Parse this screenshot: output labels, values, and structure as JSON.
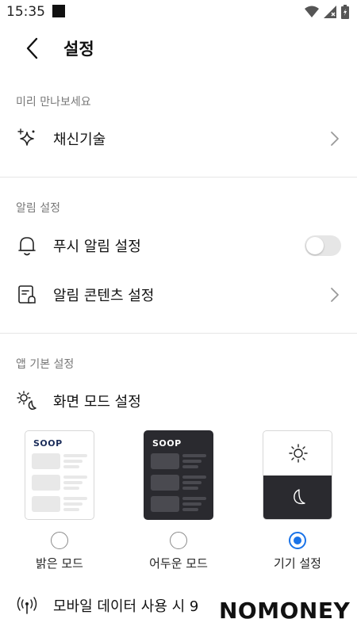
{
  "status_bar": {
    "time": "15:35"
  },
  "header": {
    "title": "설정"
  },
  "sections": {
    "preview": {
      "label": "미리 만나보세요",
      "item_label": "채신기술"
    },
    "notifications": {
      "label": "알림 설정",
      "push_label": "푸시 알림 설정",
      "push_enabled": false,
      "content_label": "알림 콘텐츠 설정"
    },
    "app_basic": {
      "label": "앱 기본 설정",
      "screen_mode_label": "화면 모드 설정",
      "modes": [
        {
          "label": "밝은 모드",
          "selected": false
        },
        {
          "label": "어두운 모드",
          "selected": false
        },
        {
          "label": "기기 설정",
          "selected": true
        }
      ],
      "card_logo": "SOOP",
      "mobile_data_label": "모바일 데이터 사용 시 9"
    }
  },
  "watermark": {
    "text": "NOMONEY"
  },
  "colors": {
    "accent": "#1a73e8",
    "dark_card": "#2a2a2f"
  }
}
